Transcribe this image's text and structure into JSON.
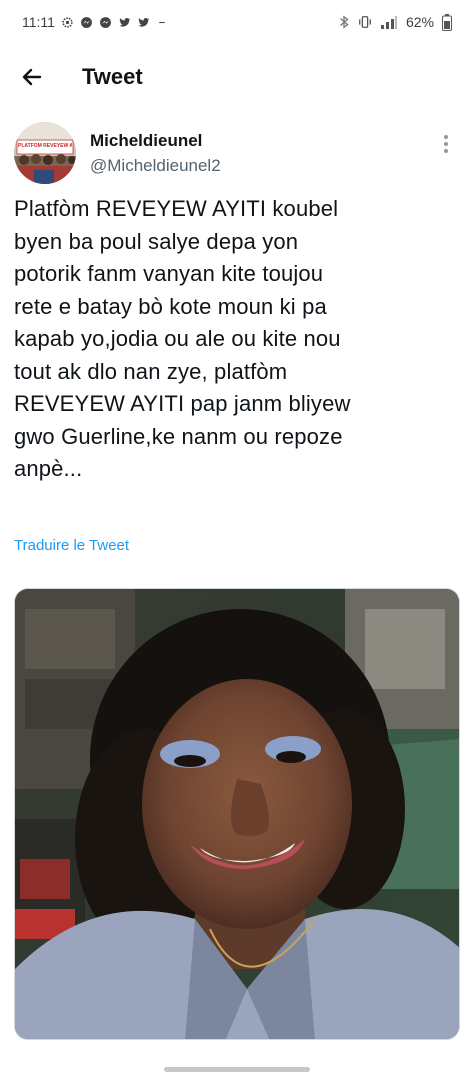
{
  "status_bar": {
    "time": "11:11",
    "notification_icons": [
      "settings-icon",
      "messenger-icon",
      "messenger-icon",
      "twitter-icon",
      "twitter-icon",
      "minus-icon"
    ],
    "battery": "62%"
  },
  "header": {
    "title": "Tweet"
  },
  "author": {
    "display_name": "Micheldieunel",
    "handle": "@Micheldieunel2",
    "avatar_banner_text": "PLATFÒM REVEYEW AYITI"
  },
  "tweet": {
    "text": "Platfòm REVEYEW AYITI koubel\nbyen ba poul salye depa yon\npotorik fanm vanyan kite toujou\nrete e batay bò kote moun ki pa\nkapab yo,jodia ou ale ou kite nou\ntout ak dlo nan zye, platfòm\nREVEYEW AYITI pap janm bliyew\ngwo Guerline,ke nanm ou repoze\nanpè...",
    "translate_label": "Traduire le Tweet"
  },
  "colors": {
    "link": "#1d9bf0",
    "text": "#0f1419",
    "secondary": "#536471"
  }
}
